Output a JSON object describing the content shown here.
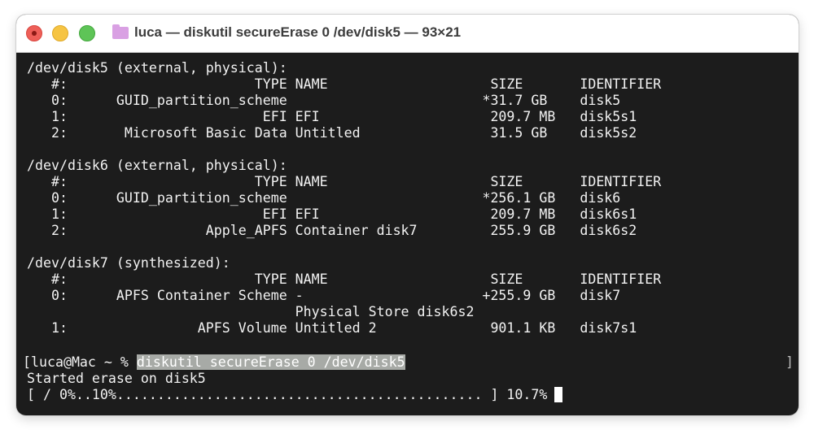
{
  "window": {
    "title": "luca — diskutil secureErase 0 /dev/disk5 — 93×21"
  },
  "terminal": {
    "lines": [
      "/dev/disk5 (external, physical):",
      "   #:                       TYPE NAME                    SIZE       IDENTIFIER",
      "   0:      GUID_partition_scheme                        *31.7 GB    disk5",
      "   1:                        EFI EFI                     209.7 MB   disk5s1",
      "   2:       Microsoft Basic Data Untitled                31.5 GB    disk5s2",
      "",
      "/dev/disk6 (external, physical):",
      "   #:                       TYPE NAME                    SIZE       IDENTIFIER",
      "   0:      GUID_partition_scheme                        *256.1 GB   disk6",
      "   1:                        EFI EFI                     209.7 MB   disk6s1",
      "   2:                 Apple_APFS Container disk7         255.9 GB   disk6s2",
      "",
      "/dev/disk7 (synthesized):",
      "   #:                       TYPE NAME                    SIZE       IDENTIFIER",
      "   0:      APFS Container Scheme -                      +255.9 GB   disk7",
      "                                 Physical Store disk6s2",
      "   1:                APFS Volume Untitled 2              901.1 KB   disk7s1"
    ],
    "prompt": "[luca@Mac ~ % ",
    "command": "diskutil secureErase 0 /dev/disk5",
    "prompt_end": "]",
    "output": "Started erase on disk5",
    "progress_text": "[ / 0%..10%............................................. ] 10.7%",
    "progress_percent": 10.7
  }
}
